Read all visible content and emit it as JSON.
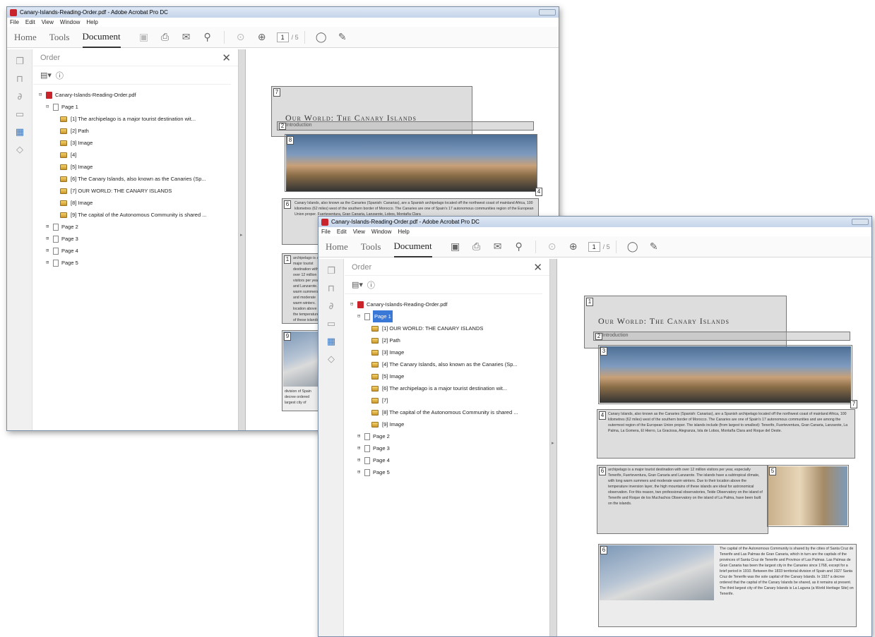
{
  "window1": {
    "title": "Canary-Islands-Reading-Order.pdf - Adobe Acrobat Pro DC",
    "menu": [
      "File",
      "Edit",
      "View",
      "Window",
      "Help"
    ],
    "tabs": {
      "home": "Home",
      "tools": "Tools",
      "document": "Document"
    },
    "page_current": "1",
    "page_total": "/ 5",
    "panel_title": "Order",
    "file_name": "Canary-Islands-Reading-Order.pdf",
    "page1_label": "Page 1",
    "items": [
      "[1] The archipelago is a major tourist destination wit...",
      "[2] Path",
      "[3] Image",
      "[4]",
      "[5] Image",
      "[6] The Canary Islands, also known as the Canaries (Sp...",
      "[7] OUR WORLD: THE CANARY ISLANDS",
      "[8] Image",
      "[9] The capital of the Autonomous Community is shared ..."
    ],
    "other_pages": [
      "Page 2",
      "Page 3",
      "Page 4",
      "Page 5"
    ],
    "doc": {
      "title": "Our World: The Canary Islands",
      "subtitle": "Introduction",
      "n_title": "7",
      "n_sub": "2",
      "n_img": "8",
      "n_side": "4",
      "n_p1": "6",
      "n_p2": "1",
      "n_p3": "9",
      "p1": "Canary Islands, also known as the Canaries (Spanish: Canarias), are a Spanish archipelago located off the northwest coast of mainland Africa, 100 kilometres (62 miles) west of the southern border of Morocco. The Canaries are one of Spain's 17 autonomous communities region of the European Union proper. Fuerteventura, Gran Canaria, Lanzarote, Lobos, Montaña Clara",
      "p2": "archipelago is a major tourist destination with over 12 million visitors per year, and Lanzarote. warm summers and moderate warm winters. location above the temperature of these islands are ideal. reason, two professional observatories, Island of Tenerife and Island of La Palma",
      "p3": "division of Spain decree ordered largest city of"
    }
  },
  "window2": {
    "title": "Canary-Islands-Reading-Order.pdf - Adobe Acrobat Pro DC",
    "menu": [
      "File",
      "Edit",
      "View",
      "Window",
      "Help"
    ],
    "tabs": {
      "home": "Home",
      "tools": "Tools",
      "document": "Document"
    },
    "page_current": "1",
    "page_total": "/ 5",
    "panel_title": "Order",
    "file_name": "Canary-Islands-Reading-Order.pdf",
    "page1_label": "Page 1",
    "items": [
      "[1] OUR WORLD: THE CANARY ISLANDS",
      "[2] Path",
      "[3] Image",
      "[4] The Canary Islands, also known as the Canaries (Sp...",
      "[5] Image",
      "[6] The archipelago is a major tourist destination wit...",
      "[7]",
      "[8] The capital of the Autonomous Community is shared ...",
      "[9] Image"
    ],
    "other_pages": [
      "Page 2",
      "Page 3",
      "Page 4",
      "Page 5"
    ],
    "doc": {
      "title": "Our World: The Canary Islands",
      "subtitle": "Introduction",
      "n_title": "1",
      "n_sub": "2",
      "n_img": "3",
      "n_side": "7",
      "n_p1": "4",
      "n_p2": "6",
      "n_img2": "5",
      "n_img3": "6",
      "p1": "Canary Islands, also known as the Canaries (Spanish: Canarias), are a Spanish archipelago located off the northwest coast of mainland Africa, 100 kilometres (62 miles) west of the southern border of Morocco. The Canaries are one of Spain's 17 autonomous communities and are among the outermost region of the European Union proper. The islands include (from largest to smallest): Tenerife, Fuerteventura, Gran Canaria, Lanzarote, La Palma, La Gomera, El Hierro, La Graciosa, Alegranza, Isla de Lobos, Montaña Clara and Roque del Oeste.",
      "p2": "archipelago is a major tourist destination with over 12 million visitors per year, especially Tenerife, Fuerteventura, Gran Canaria and Lanzarote. The islands have a subtropical climate, with long warm summers and moderate warm winters. Due to their location above the temperature inversion layer, the high mountains of these islands are ideal for astronomical observation. For this reason, two professional observatories, Teide Observatory on the island of Tenerife and Roque de los Muchachos Observatory on the island of La Palma, have been built on the islands.",
      "p3": "The capital of the Autonomous Community is shared by the cities of Santa Cruz de Tenerife and Las Palmas de Gran Canaria, which in turn are the capitals of the provinces of Santa Cruz de Tenerife and Province of Las Palmas. Las Palmas de Gran Canaria has been the largest city in the Canaries since 1768, except for a brief period in 1910. Between the 1833 territorial division of Spain and 1927 Santa Cruz de Tenerife was the sole capital of the Canary Islands. In 1927 a decree ordered that the capital of the Canary Islands be shared, as it remains at present. The third largest city of the Canary Islands is La Laguna (a World Heritage Site) on Tenerife."
    }
  }
}
